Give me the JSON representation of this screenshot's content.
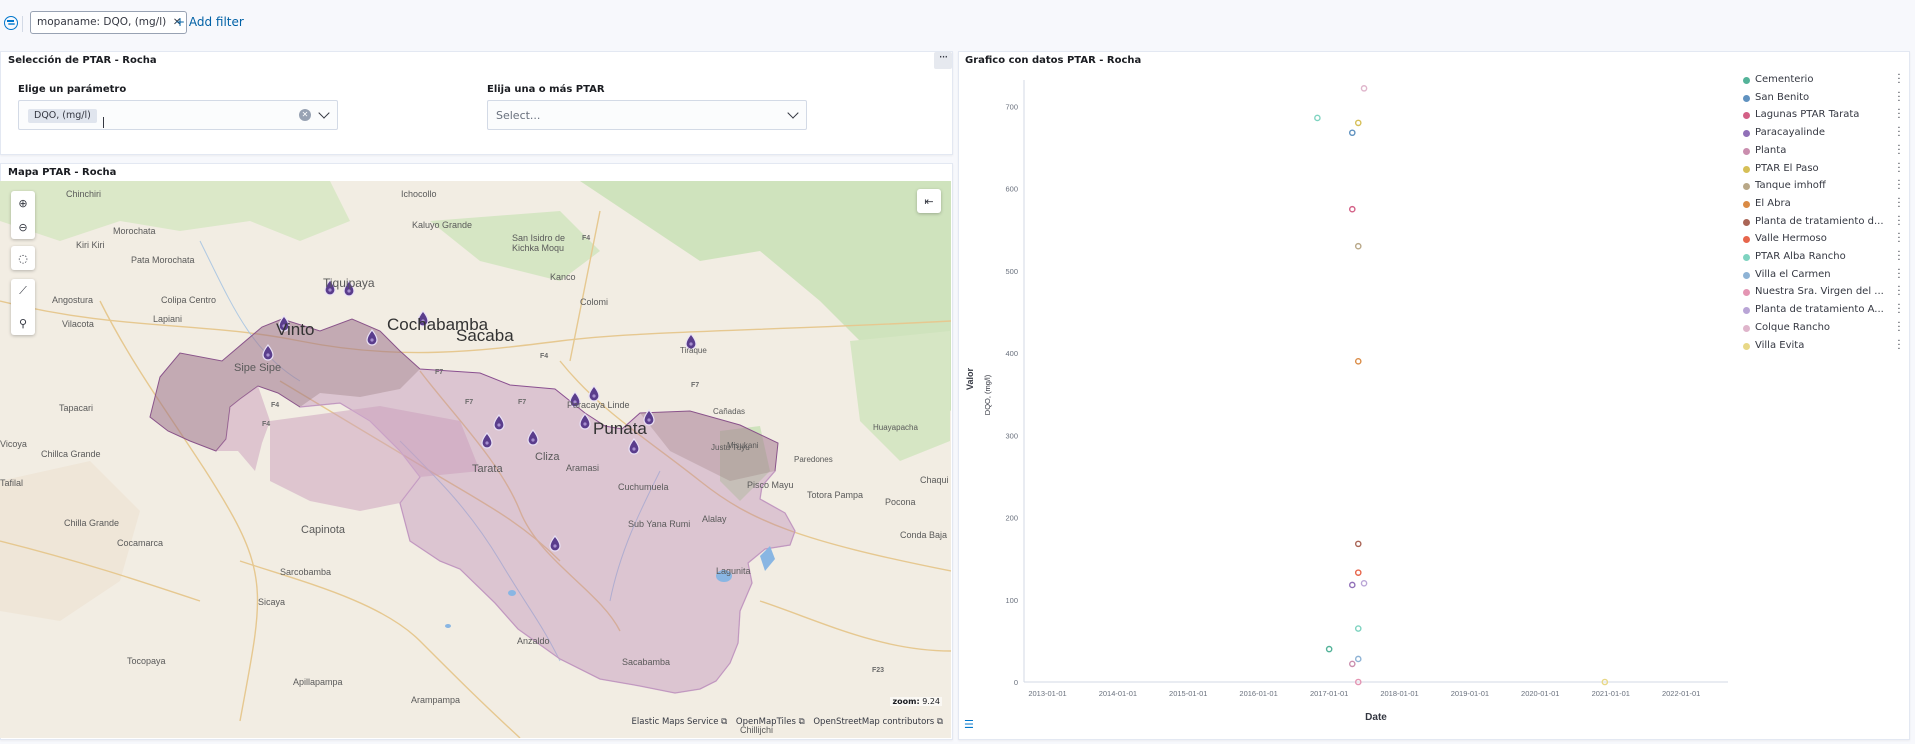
{
  "filter_bar": {
    "pill_label": "mopaname: DQO, (mg/l)",
    "add_filter": "+ Add filter"
  },
  "selection_panel": {
    "title": "Selección de PTAR - Rocha",
    "param_label": "Elige un parámetro",
    "param_selected": "DQO, (mg/l)",
    "ptar_label": "Elija una o más PTAR",
    "ptar_placeholder": "Select..."
  },
  "map_panel": {
    "title": "Mapa PTAR - Rocha",
    "zoom_label": "zoom:",
    "zoom_value": "9.24",
    "attributions": [
      "Elastic Maps Service",
      "OpenMapTiles",
      "OpenStreetMap contributors"
    ],
    "places": [
      "Chinchiri",
      "Ichocollo",
      "Kaluyo Grande",
      "San Isidro de",
      "Kichka Moqu",
      "Morochata",
      "Kiri Kiri",
      "Pata Morochata",
      "Tiquipaya",
      "Kanco",
      "Colomi",
      "Angostura",
      "Colipa Centro",
      "Lapiani",
      "Vilacota",
      "Vinto",
      "Cochabamba",
      "Sacaba",
      "Sipe Sipe",
      "Tiraque",
      "Tapacari",
      "Cañadas",
      "Huayapacha",
      "Paracaya Linde",
      "Punata",
      "Chillca Grande",
      "Misukani",
      "Paredones",
      "Cliza",
      "Aramasi",
      "Justu Tuyu",
      "Pisco Mayu",
      "Totora Pampa",
      "Chaqui",
      "Tarata",
      "Cuchumuela",
      "Pocona",
      "Chilla Grande",
      "Capinota",
      "Cocamarca",
      "Sub Yana Rumi",
      "Alalay",
      "Conda Baja",
      "Sarcobamba",
      "Lagunita",
      "Sicaya",
      "Anzaldo",
      "Sacabamba",
      "Tocopaya",
      "Apillapampa",
      "Arampampa",
      "Chillijchi",
      "Tafilal",
      "Vicoya"
    ],
    "roads": [
      "F4",
      "F4",
      "F7",
      "F7",
      "F7",
      "F7",
      "F4",
      "F4",
      "F23"
    ]
  },
  "chart_panel": {
    "title": "Grafico con datos PTAR - Rocha",
    "legend_menu_icon": "vertical-dots-icon",
    "list_icon": "list-icon"
  },
  "chart_data": {
    "type": "scatter",
    "title": "",
    "xlabel": "Date",
    "ylabel": "Valor",
    "ylabel_sub": "DQO, (mg/l)",
    "ylim": [
      0,
      720
    ],
    "yticks": [
      0,
      100,
      200,
      300,
      400,
      500,
      600,
      700
    ],
    "xticks": [
      "2013-01-01",
      "2014-01-01",
      "2015-01-01",
      "2016-01-01",
      "2017-01-01",
      "2018-01-01",
      "2019-01-01",
      "2020-01-01",
      "2021-01-01",
      "2022-01-01"
    ],
    "series": [
      {
        "name": "Cementerio",
        "color": "#54b399",
        "points": [
          [
            "2017-01-01",
            40
          ]
        ]
      },
      {
        "name": "San Benito",
        "color": "#6092c0",
        "points": [
          [
            "2017-05-01",
            668
          ]
        ]
      },
      {
        "name": "Lagunas PTAR Tarata",
        "color": "#d36086",
        "points": [
          [
            "2017-05-01",
            575
          ]
        ]
      },
      {
        "name": "Paracayalinde",
        "color": "#9170b8",
        "points": [
          [
            "2017-05-01",
            118
          ]
        ]
      },
      {
        "name": "Planta",
        "color": "#ca8eae",
        "points": [
          [
            "2017-05-01",
            22
          ]
        ]
      },
      {
        "name": "PTAR El Paso",
        "color": "#d6bf57",
        "points": [
          [
            "2017-06-01",
            680
          ]
        ]
      },
      {
        "name": "Tanque imhoff",
        "color": "#b9a888",
        "points": [
          [
            "2017-06-01",
            530
          ]
        ]
      },
      {
        "name": "El Abra",
        "color": "#da8b45",
        "points": [
          [
            "2017-06-01",
            390
          ]
        ]
      },
      {
        "name": "Planta de tratamiento d...",
        "color": "#aa6556",
        "points": [
          [
            "2017-06-01",
            168
          ]
        ]
      },
      {
        "name": "Valle Hermoso",
        "color": "#e7664c",
        "points": [
          [
            "2017-06-01",
            133
          ]
        ]
      },
      {
        "name": "PTAR Alba Rancho",
        "color": "#7ed3c0",
        "points": [
          [
            "2016-11-01",
            686
          ],
          [
            "2017-06-01",
            65
          ]
        ]
      },
      {
        "name": "Villa el Carmen",
        "color": "#8eb3d5",
        "points": [
          [
            "2017-06-01",
            28
          ]
        ]
      },
      {
        "name": "Nuestra Sra. Virgen del ...",
        "color": "#e495b3",
        "points": [
          [
            "2017-06-01",
            0
          ]
        ]
      },
      {
        "name": "Planta de tratamiento A...",
        "color": "#b9a5d6",
        "points": [
          [
            "2017-07-01",
            120
          ]
        ]
      },
      {
        "name": "Colque Rancho",
        "color": "#dfb5cb",
        "points": [
          [
            "2017-07-01",
            722
          ]
        ]
      },
      {
        "name": "Villa Evita",
        "color": "#e8d887",
        "points": [
          [
            "2020-12-01",
            0
          ]
        ]
      }
    ]
  }
}
